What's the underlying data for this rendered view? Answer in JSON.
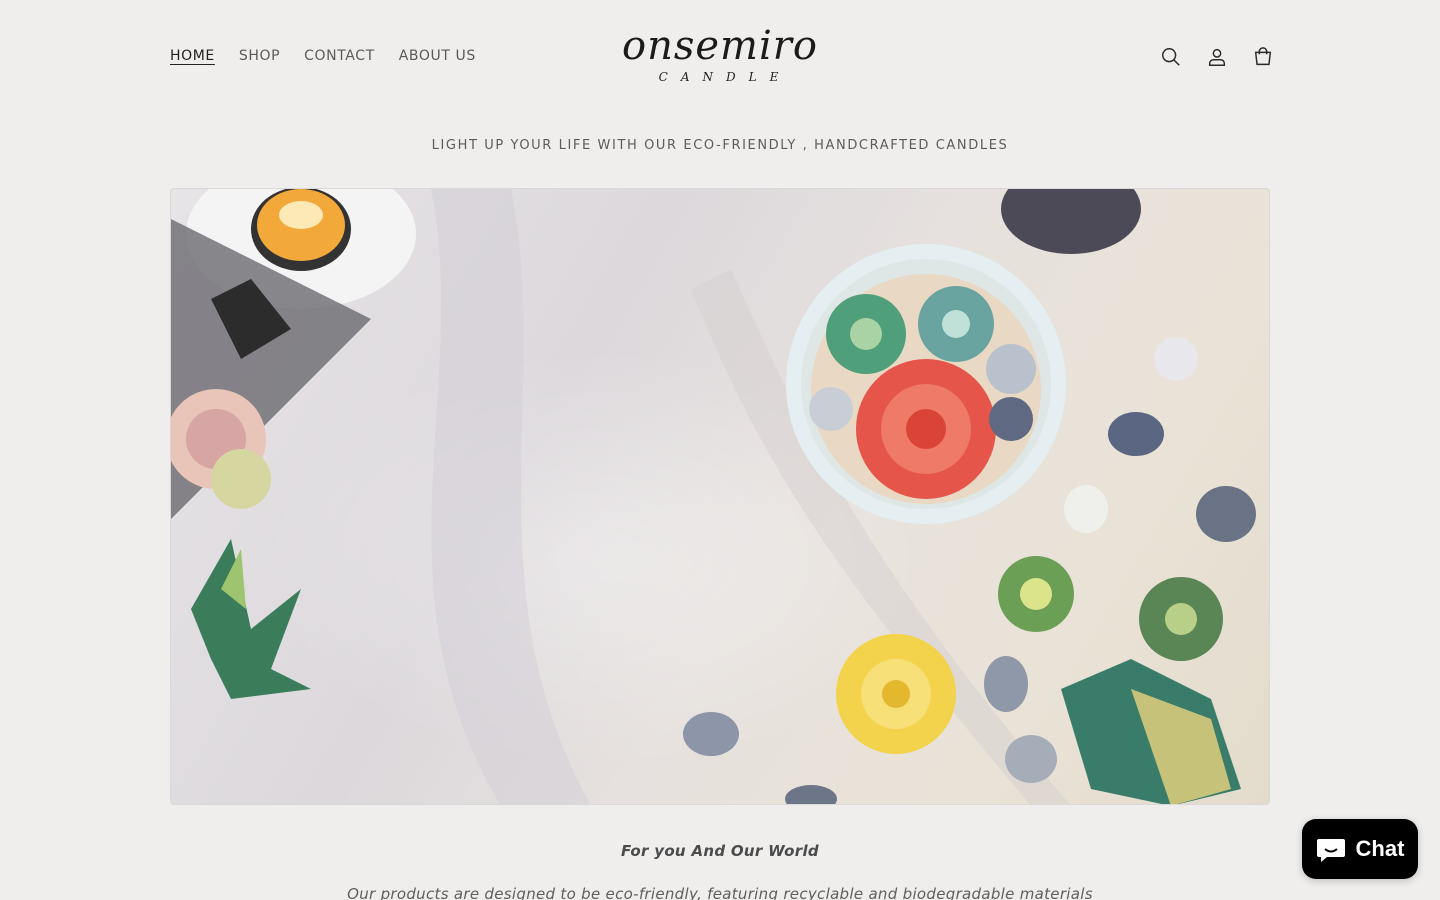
{
  "nav": {
    "items": [
      {
        "label": "HOME",
        "active": true
      },
      {
        "label": "SHOP",
        "active": false
      },
      {
        "label": "CONTACT",
        "active": false
      },
      {
        "label": "ABOUT US",
        "active": false
      }
    ]
  },
  "logo": {
    "wordmark": "onsemiro",
    "subtitle": "CANDLE"
  },
  "header_icons": [
    "search-icon",
    "account-icon",
    "cart-icon"
  ],
  "tagline": "LIGHT UP YOUR LIFE WITH OUR ECO-FRIENDLY , HANDCRAFTED CANDLES",
  "hero": {
    "image": "hero-image-succulent-candles"
  },
  "section": {
    "heading": "For you And Our World",
    "body": "Our products are designed to be eco-friendly, featuring recyclable and biodegradable materials"
  },
  "chat": {
    "label": "Chat",
    "icon": "chat-bubble-icon",
    "background": "#000000"
  },
  "colors": {
    "page_background": "#efeeed",
    "text": "#4a4a4a"
  }
}
